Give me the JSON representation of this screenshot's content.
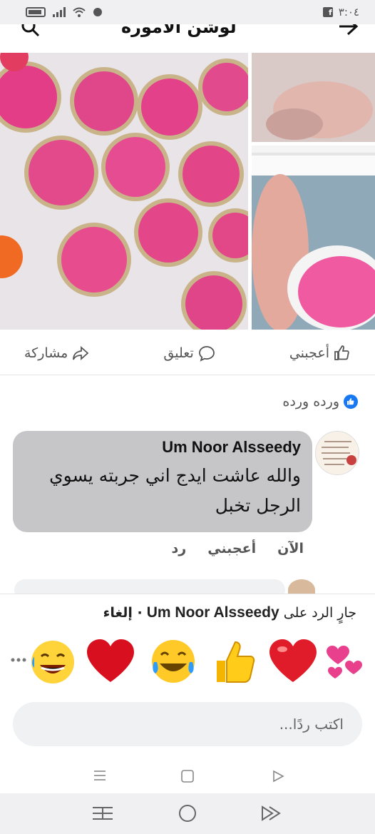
{
  "status_bar": {
    "time": "٣:٠٤"
  },
  "header": {
    "title": "لوشن الاموره"
  },
  "actions": {
    "like_label": "أعجبني",
    "comment_label": "تعليق",
    "share_label": "مشاركة"
  },
  "reactors": {
    "names": "ورده ورده"
  },
  "comment": {
    "author": "Um Noor Alsseedy",
    "text": "والله عاشت ايدج اني جربته يسوي الرجل تخبل",
    "time": "الآن",
    "like_label": "أعجبني",
    "reply_label": "رد"
  },
  "reply_bar": {
    "prefix": "جارٍ الرد على",
    "name": "Um Noor Alsseedy",
    "cancel": "· إلغاء"
  },
  "reply_input": {
    "placeholder": "اكتب ردًا..."
  },
  "colors": {
    "accent": "#1877f2",
    "bubble": "#c6c6c8",
    "pink": "#e0508a"
  }
}
